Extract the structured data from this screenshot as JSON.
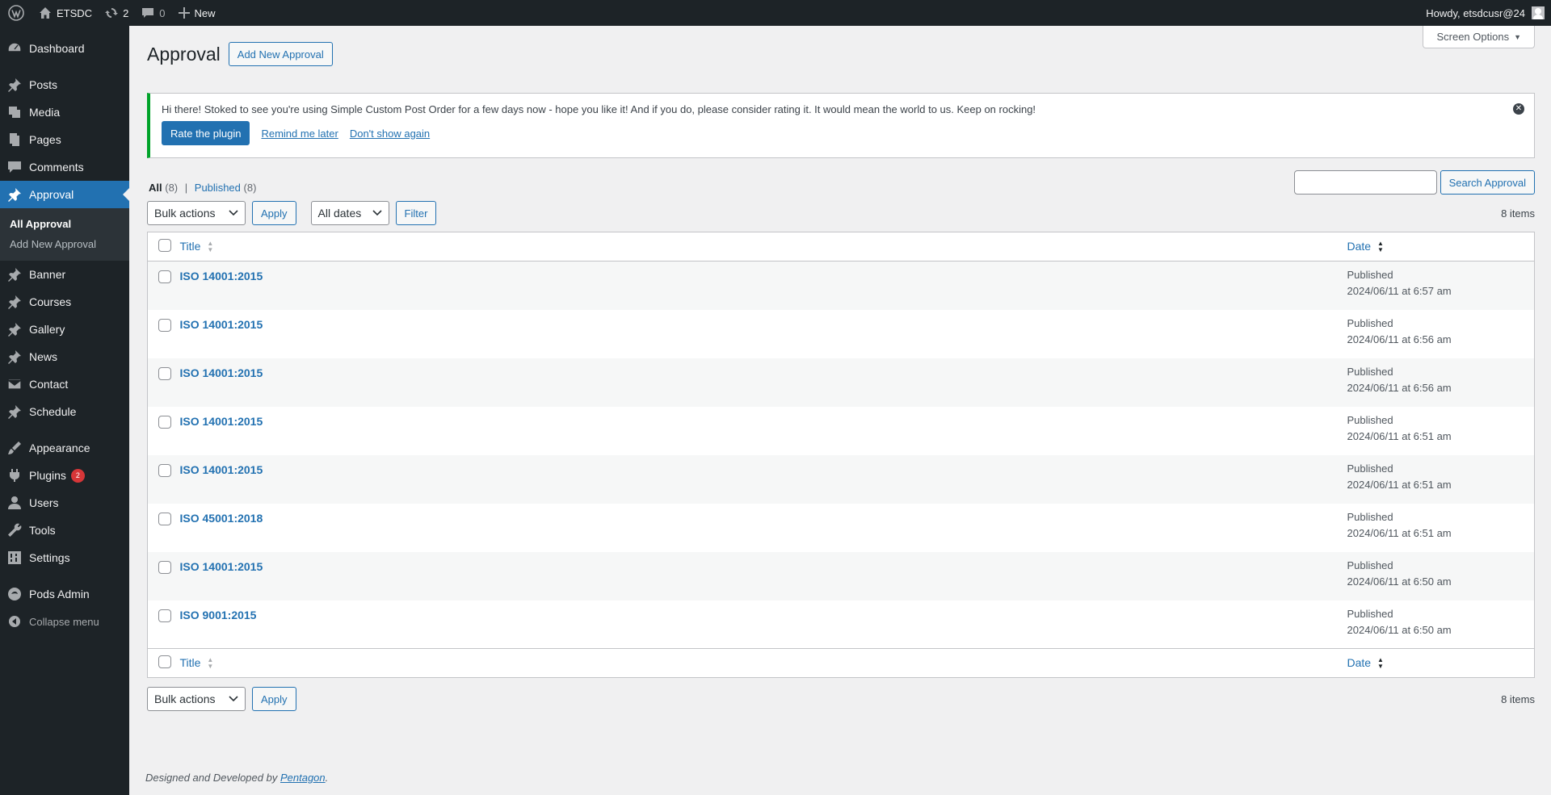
{
  "adminbar": {
    "site_name": "ETSDC",
    "updates_count": "2",
    "comments_count": "0",
    "new_label": "New",
    "howdy": "Howdy, etsdcusr@24"
  },
  "sidebar": {
    "items": [
      {
        "label": "Dashboard",
        "icon": "dashboard-icon"
      },
      {
        "label": "Posts",
        "icon": "pin-icon"
      },
      {
        "label": "Media",
        "icon": "media-icon"
      },
      {
        "label": "Pages",
        "icon": "pages-icon"
      },
      {
        "label": "Comments",
        "icon": "comment-icon"
      },
      {
        "label": "Approval",
        "icon": "pin-icon"
      },
      {
        "label": "Banner",
        "icon": "pin-icon"
      },
      {
        "label": "Courses",
        "icon": "pin-icon"
      },
      {
        "label": "Gallery",
        "icon": "pin-icon"
      },
      {
        "label": "News",
        "icon": "pin-icon"
      },
      {
        "label": "Contact",
        "icon": "mail-icon"
      },
      {
        "label": "Schedule",
        "icon": "pin-icon"
      },
      {
        "label": "Appearance",
        "icon": "brush-icon"
      },
      {
        "label": "Plugins",
        "icon": "plugin-icon",
        "badge": "2"
      },
      {
        "label": "Users",
        "icon": "user-icon"
      },
      {
        "label": "Tools",
        "icon": "wrench-icon"
      },
      {
        "label": "Settings",
        "icon": "settings-icon"
      },
      {
        "label": "Pods Admin",
        "icon": "pods-icon"
      }
    ],
    "submenu": [
      "All Approval",
      "Add New Approval"
    ],
    "collapse_label": "Collapse menu"
  },
  "page": {
    "screen_options": "Screen Options",
    "title": "Approval",
    "add_new": "Add New Approval"
  },
  "notice": {
    "text": "Hi there! Stoked to see you're using Simple Custom Post Order for a few days now - hope you like it! And if you do, please consider rating it. It would mean the world to us. Keep on rocking!",
    "rate": "Rate the plugin",
    "remind": "Remind me later",
    "dont_show": "Don't show again"
  },
  "filters": {
    "all_label": "All",
    "all_count": "(8)",
    "published_label": "Published",
    "published_count": "(8)",
    "search_button": "Search Approval",
    "bulk_actions": "Bulk actions",
    "apply": "Apply",
    "all_dates": "All dates",
    "filter": "Filter",
    "items_count": "8 items"
  },
  "table": {
    "col_title": "Title",
    "col_date": "Date",
    "rows": [
      {
        "title": "ISO 14001:2015",
        "status": "Published",
        "date": "2024/06/11 at 6:57 am"
      },
      {
        "title": "ISO 14001:2015",
        "status": "Published",
        "date": "2024/06/11 at 6:56 am"
      },
      {
        "title": "ISO 14001:2015",
        "status": "Published",
        "date": "2024/06/11 at 6:56 am"
      },
      {
        "title": "ISO 14001:2015",
        "status": "Published",
        "date": "2024/06/11 at 6:51 am"
      },
      {
        "title": "ISO 14001:2015",
        "status": "Published",
        "date": "2024/06/11 at 6:51 am"
      },
      {
        "title": "ISO 45001:2018",
        "status": "Published",
        "date": "2024/06/11 at 6:51 am"
      },
      {
        "title": "ISO 14001:2015",
        "status": "Published",
        "date": "2024/06/11 at 6:50 am"
      },
      {
        "title": "ISO 9001:2015",
        "status": "Published",
        "date": "2024/06/11 at 6:50 am"
      }
    ]
  },
  "footer": {
    "text": "Designed and Developed by",
    "link": "Pentagon",
    "period": "."
  }
}
